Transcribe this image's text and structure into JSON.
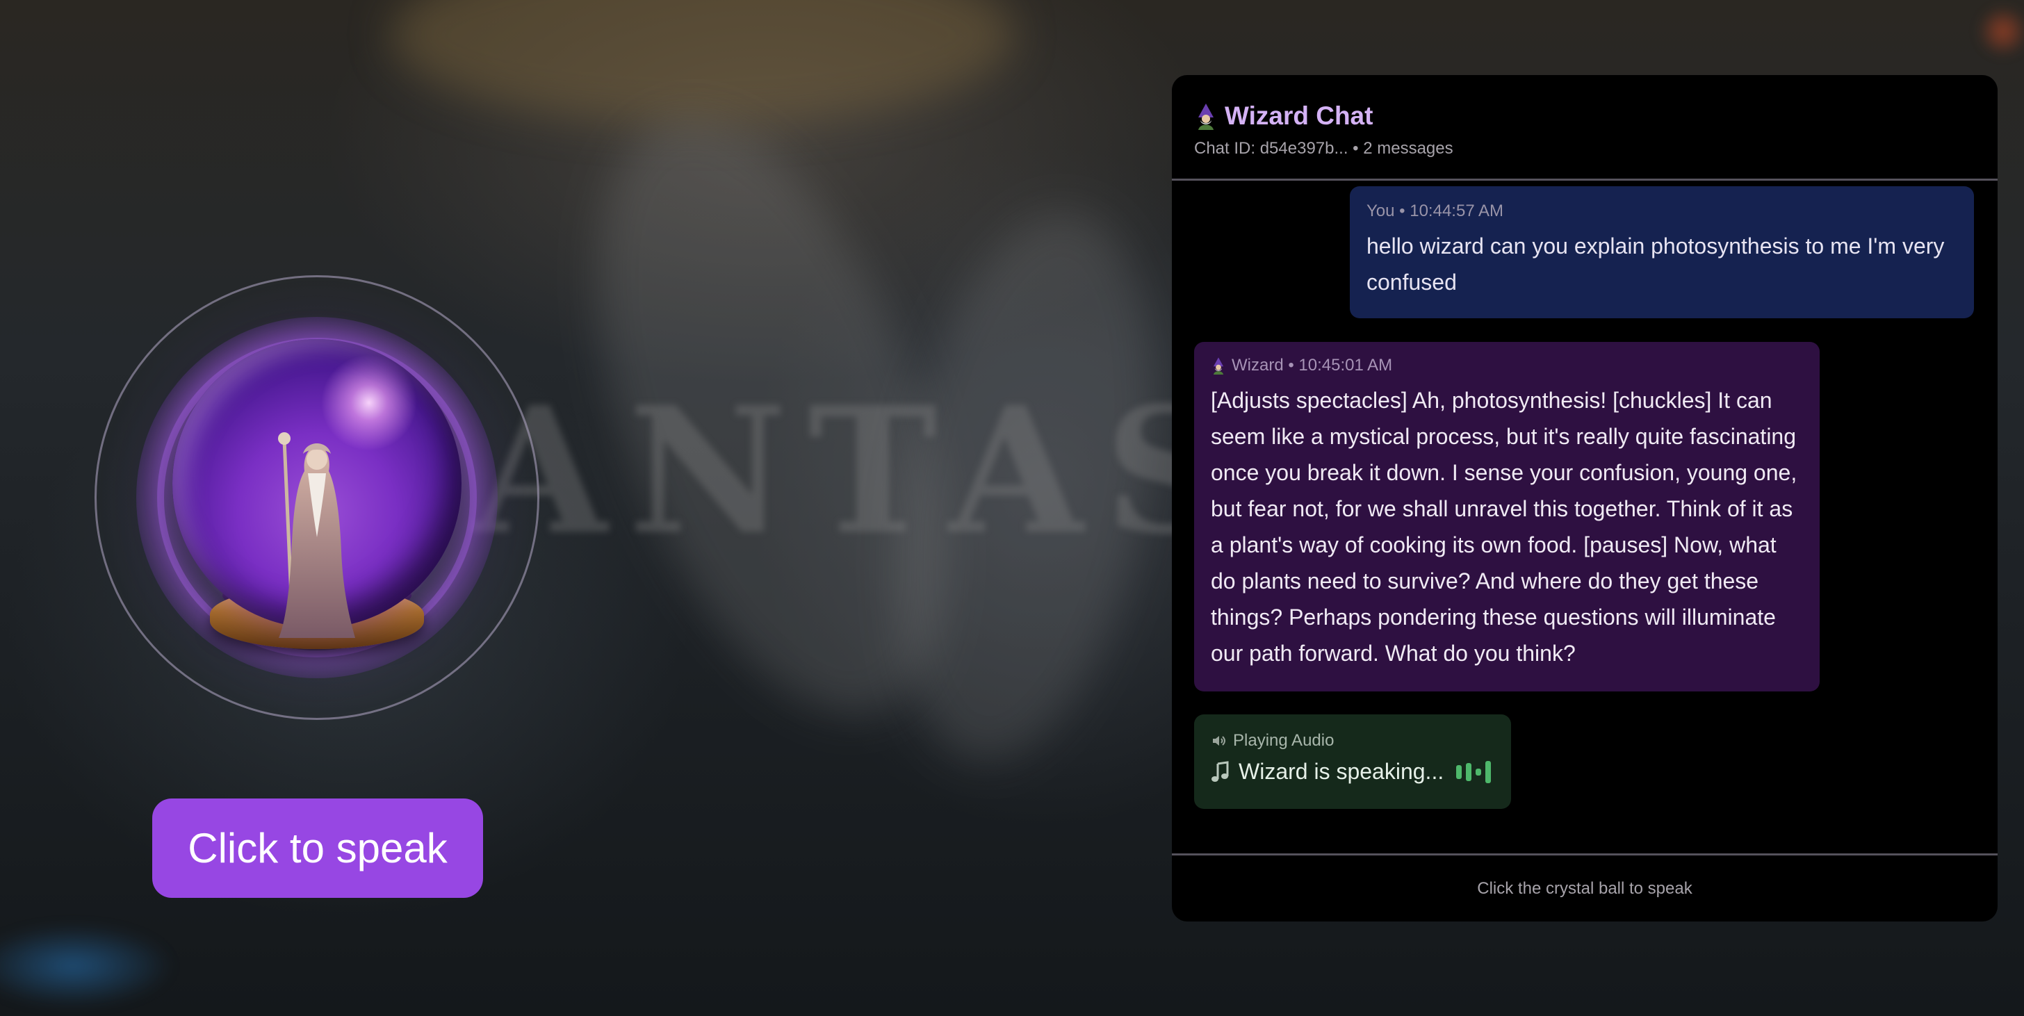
{
  "background": {
    "word": "ANTAS"
  },
  "orb": {
    "button_label": "Click to speak"
  },
  "chat": {
    "title": "Wizard Chat",
    "title_icon": "wizard-icon",
    "chat_id_line": "Chat ID: d54e397b... • 2 messages",
    "messages": [
      {
        "sender": "You",
        "time": "10:44:57 AM",
        "header": "You • 10:44:57 AM",
        "text": "hello wizard can you explain photosynthesis to me I'm very confused"
      },
      {
        "sender": "Wizard",
        "time": "10:45:01 AM",
        "header": "Wizard • 10:45:01 AM",
        "icon": "wizard-icon",
        "text": "[Adjusts spectacles] Ah, photosynthesis! [chuckles] It can seem like a mystical process, but it's really quite fascinating once you break it down. I sense your confusion, young one, but fear not, for we shall unravel this together. Think of it as a plant's way of cooking its own food. [pauses] Now, what do plants need to survive? And where do they get these things? Perhaps pondering these questions will illuminate our path forward. What do you think?"
      }
    ],
    "audio_status": {
      "header": "Playing Audio",
      "icon": "speaker-icon",
      "text": "Wizard is speaking...",
      "text_icon": "music-note-icon"
    },
    "footer_hint": "Click the crystal ball to speak"
  },
  "colors": {
    "accent_purple": "#9747e3",
    "title_purple": "#d4b2f5",
    "user_bubble": "#152250",
    "wizard_bubble": "#2e1041",
    "audio_bubble": "#15291b",
    "audio_eq": "#4eb86b"
  }
}
